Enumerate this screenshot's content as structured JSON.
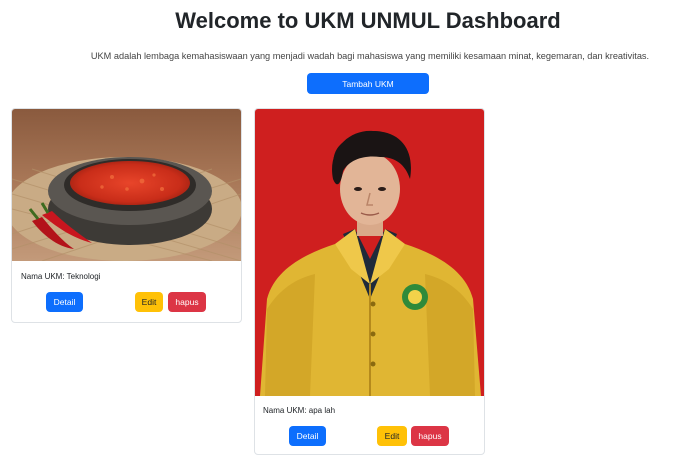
{
  "header": {
    "title": "Welcome to UKM UNMUL Dashboard",
    "description": "UKM adalah lembaga kemahasiswaan yang menjadi wadah bagi mahasiswa yang memiliki kesamaan minat, kegemaran, dan kreativitas.",
    "add_button_label": "Tambah UKM"
  },
  "cards": [
    {
      "name_label": "Nama UKM: Teknologi",
      "image_icon": "sambal-bowl-photo",
      "detail_label": "Detail",
      "edit_label": "Edit",
      "delete_label": "hapus"
    },
    {
      "name_label": "Nama UKM: apa lah",
      "image_icon": "student-portrait-photo",
      "detail_label": "Detail",
      "edit_label": "Edit",
      "delete_label": "hapus"
    }
  ],
  "colors": {
    "primary": "#0d6efd",
    "warning": "#ffc107",
    "danger": "#dc3545",
    "portrait_background": "#cf1f1f"
  }
}
